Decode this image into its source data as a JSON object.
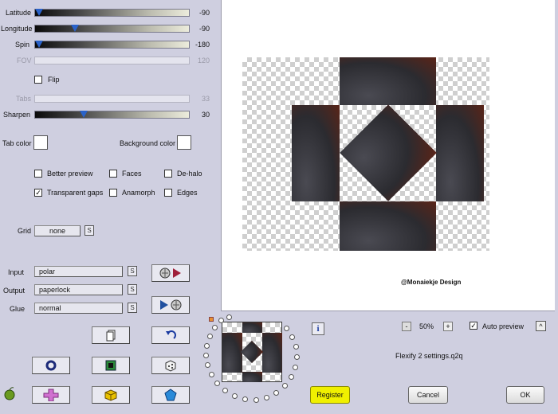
{
  "sliders": [
    {
      "label": "Latitude",
      "value": "-90",
      "fraction": 0.0,
      "disabled": false
    },
    {
      "label": "Longitude",
      "value": "-90",
      "fraction": 0.25,
      "disabled": false
    },
    {
      "label": "Spin",
      "value": "-180",
      "fraction": 0.0,
      "disabled": false
    },
    {
      "label": "FOV",
      "value": "120",
      "fraction": null,
      "disabled": true
    },
    {
      "label": "Tabs",
      "value": "33",
      "fraction": null,
      "disabled": true
    },
    {
      "label": "Sharpen",
      "value": "30",
      "fraction": 0.3,
      "disabled": false
    }
  ],
  "flip": {
    "label": "Flip",
    "checked": false
  },
  "tab_color_label": "Tab color",
  "background_color_label": "Background color",
  "options": {
    "better_preview": {
      "label": "Better preview",
      "checked": false
    },
    "faces": {
      "label": "Faces",
      "checked": false
    },
    "de_halo": {
      "label": "De-halo",
      "checked": false
    },
    "transparent_gaps": {
      "label": "Transparent gaps",
      "checked": true
    },
    "anamorph": {
      "label": "Anamorph",
      "checked": false
    },
    "edges": {
      "label": "Edges",
      "checked": false
    }
  },
  "grid": {
    "label": "Grid",
    "value": "none"
  },
  "input": {
    "label": "Input",
    "value": "polar"
  },
  "output": {
    "label": "Output",
    "value": "paperlock"
  },
  "glue": {
    "label": "Glue",
    "value": "normal"
  },
  "s_button": "S",
  "check_mark": "✓",
  "watermark": "@Monaiekje Design",
  "zoom": {
    "minus": "-",
    "value": "50%",
    "plus": "+"
  },
  "auto_preview": {
    "label": "Auto preview",
    "checked": true,
    "btn": "^"
  },
  "settings_file": "Flexify 2 settings.q2q",
  "info_btn": "i",
  "register_btn": "Register",
  "cancel_btn": "Cancel",
  "ok_btn": "OK",
  "colors": {
    "accent_register": "#f0f000",
    "tile": "#2b2b30",
    "rust": "#5a2418",
    "thumb": "#2a62c9"
  }
}
